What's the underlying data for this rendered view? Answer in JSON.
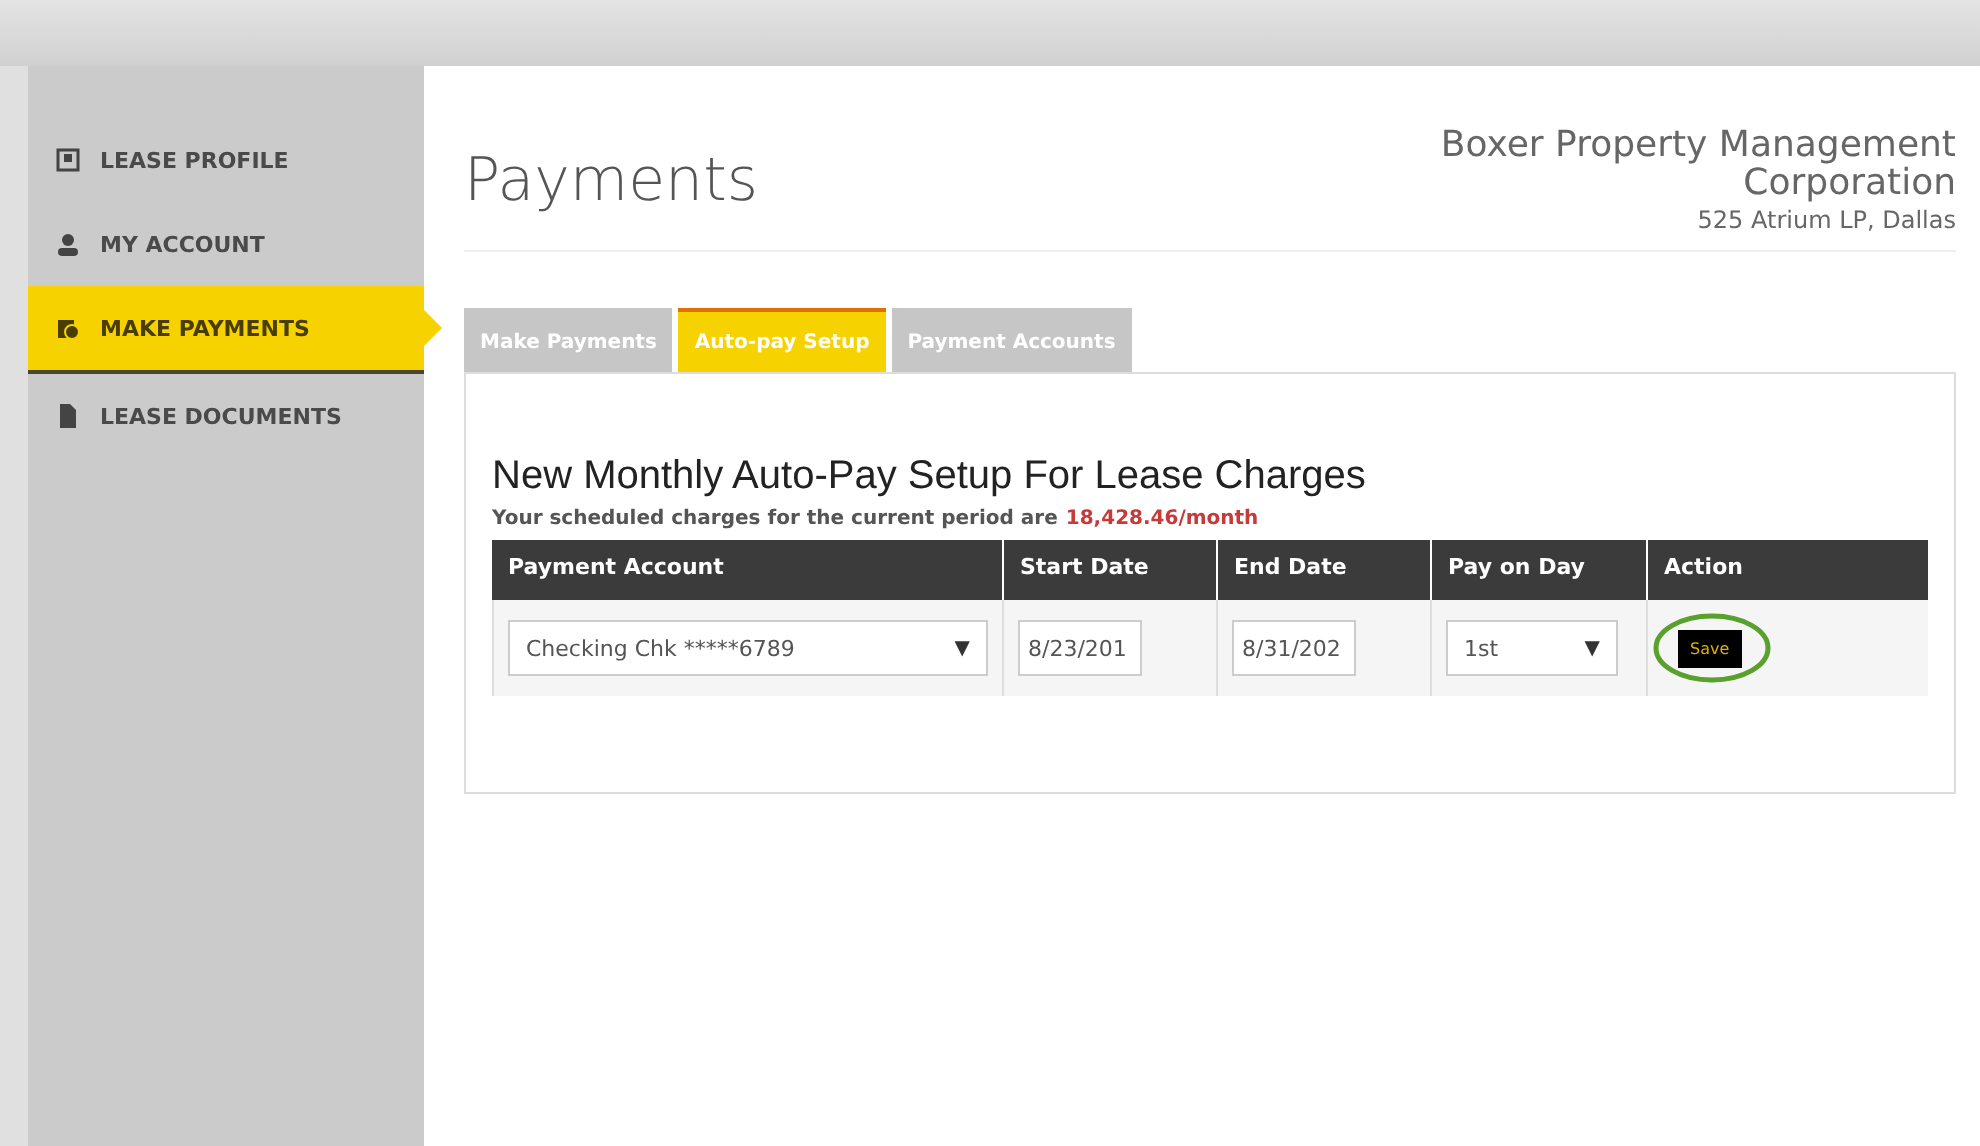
{
  "sidebar": {
    "items": [
      {
        "label": "LEASE PROFILE",
        "selected": false
      },
      {
        "label": "MY ACCOUNT",
        "selected": false
      },
      {
        "label": "MAKE PAYMENTS",
        "selected": true
      },
      {
        "label": "LEASE DOCUMENTS",
        "selected": false
      }
    ]
  },
  "page_title": "Payments",
  "company": {
    "name": "Boxer Property Management Corporation",
    "address": "525 Atrium LP, Dallas"
  },
  "tabs": [
    {
      "label": "Make Payments",
      "selected": false
    },
    {
      "label": "Auto-pay Setup",
      "selected": true
    },
    {
      "label": "Payment Accounts",
      "selected": false
    }
  ],
  "section": {
    "title": "New Monthly Auto-Pay Setup For Lease Charges",
    "charges_text": "Your scheduled charges for the current period are",
    "charges_amount": "18,428.46/month"
  },
  "table": {
    "columns": [
      "Payment Account",
      "Start Date",
      "End Date",
      "Pay on Day",
      "Action"
    ],
    "row": {
      "account": "Checking Chk *****6789",
      "dropdown_arrow": "▼",
      "start_date": "8/23/201",
      "end_date": "8/31/202",
      "pay_day": "1st",
      "pay_day_arrow": "▼",
      "action": "Save",
      "highlighted": true
    }
  }
}
